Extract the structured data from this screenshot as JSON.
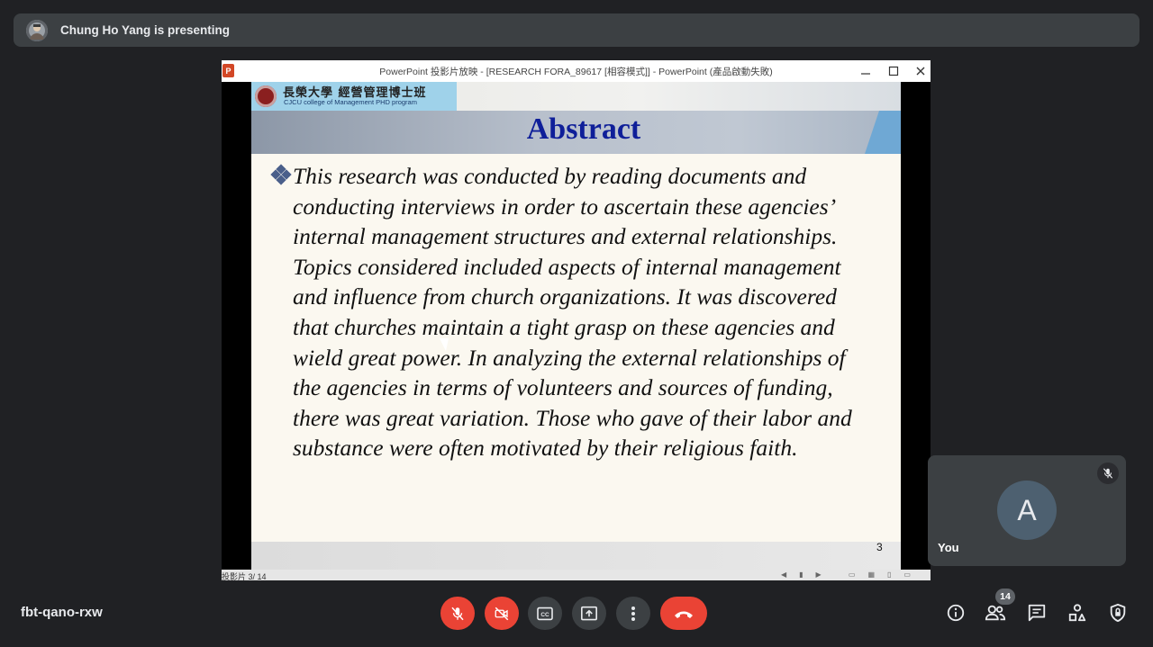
{
  "presenting_banner": {
    "text": "Chung Ho Yang is presenting"
  },
  "ppt_window": {
    "app_icon_label": "P",
    "title": "PowerPoint 投影片放映 - [RESEARCH FORA_89617 [相容模式]] - PowerPoint (產品啟動失敗)",
    "status_text": "投影片 3/ 14"
  },
  "slide": {
    "logo_chinese": "長榮大學 經營管理博士班",
    "logo_english": "CJCU college of Management PHD program",
    "title": "Abstract",
    "body": "This research was conducted by reading documents and conducting interviews in order to ascertain these agencies’ internal management structures and external relationships. Topics considered included aspects of internal management and influence from church organizations. It was discovered that churches maintain a tight grasp on these agencies and wield great power. In analyzing the external relationships of the agencies in terms of volunteers and sources of funding, there was great variation. Those who gave of their labor and substance were often motivated by their religious faith.",
    "page_number": "3"
  },
  "self_tile": {
    "avatar_letter": "A",
    "name": "You",
    "icon": "mic-off-icon"
  },
  "meeting": {
    "code": "fbt-qano-rxw"
  },
  "controls": {
    "mic": "mic-off-icon",
    "camera": "camera-off-icon",
    "captions": "captions-icon",
    "present": "present-icon",
    "more": "more-options-icon",
    "leave": "leave-call-icon"
  },
  "right_panel": {
    "participants_count": "14",
    "icons": [
      "info-icon",
      "people-icon",
      "chat-icon",
      "activities-icon",
      "host-controls-icon"
    ]
  },
  "colors": {
    "leave_red": "#ea4335",
    "slide_title": "#0f1f99",
    "background": "#202124"
  }
}
